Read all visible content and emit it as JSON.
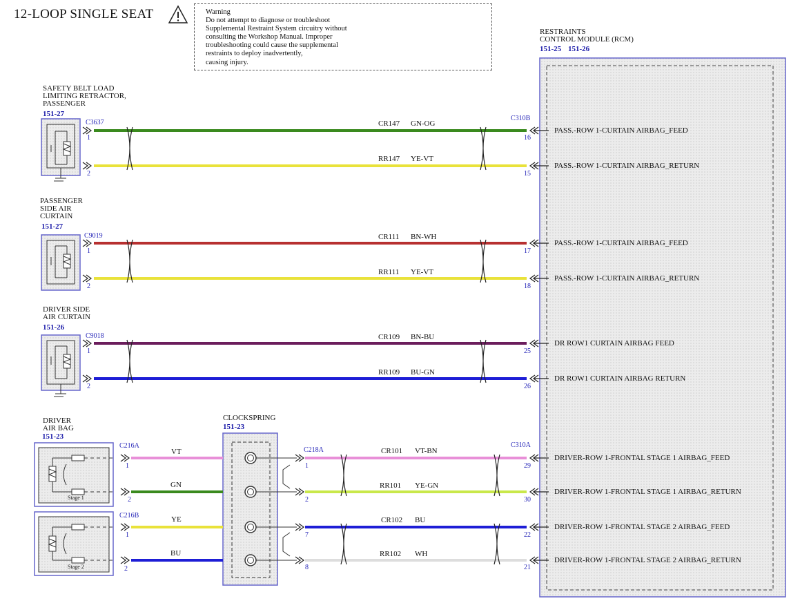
{
  "title": "12-LOOP SINGLE SEAT",
  "warning": {
    "icon": "warning-triangle-icon",
    "text": "Warning\nDo not attempt to diagnose or troubleshoot\nSupplemental Restraint System circuitry without\nconsulting the Workshop Manual. Improper\ntroubleshooting could cause the supplemental\nrestraints to deploy inadvertently,\ncausing injury."
  },
  "rcm": {
    "label": "RESTRAINTS\nCONTROL MODULE (RCM)",
    "ref1": "151-25",
    "ref2": "151-26"
  },
  "colors": {
    "GN": "#3a8a1e",
    "YE": "#e9e23a",
    "BN": "#8b2a1f",
    "RD": "#b73030",
    "VT": "#6b1d5c",
    "BU": "#1e1ed6",
    "PK": "#e88fd8",
    "LGN": "#c9e84a",
    "WH": "#dddddd",
    "frame": "#6666cc"
  },
  "components": [
    {
      "name": "SAFETY BELT LOAD\nLIMITING RETRACTOR,\nPASSENGER",
      "ref": "151-27",
      "connector": "C3637"
    },
    {
      "name": "PASSENGER\nSIDE AIR\nCURTAIN",
      "ref": "151-27",
      "connector": "C9019"
    },
    {
      "name": "DRIVER SIDE\nAIR CURTAIN",
      "ref": "151-26",
      "connector": "C9018"
    },
    {
      "name": "DRIVER\nAIR BAG",
      "ref": "151-23",
      "connectorA": "C216A",
      "connectorB": "C216B",
      "stage1": "Stage 1",
      "stage2": "Stage 2"
    }
  ],
  "clockspring": {
    "name": "CLOCKSPRING",
    "ref": "151-23",
    "connector": "C218A"
  },
  "rcm_connectors": {
    "top": "C310B",
    "bottom": "C310A"
  },
  "circuits": [
    {
      "circuit": "CR147",
      "color": "GN-OG",
      "pin_left": "1",
      "pin_rcm": "16",
      "signal": "PASS.-ROW 1-CURTAIN AIRBAG_FEED"
    },
    {
      "circuit": "RR147",
      "color": "YE-VT",
      "pin_left": "2",
      "pin_rcm": "15",
      "signal": "PASS.-ROW 1-CURTAIN AIRBAG_RETURN"
    },
    {
      "circuit": "CR111",
      "color": "BN-WH",
      "pin_left": "1",
      "pin_rcm": "17",
      "signal": "PASS.-ROW 1-CURTAIN AIRBAG_FEED"
    },
    {
      "circuit": "RR111",
      "color": "YE-VT",
      "pin_left": "2",
      "pin_rcm": "18",
      "signal": "PASS.-ROW 1-CURTAIN AIRBAG_RETURN"
    },
    {
      "circuit": "CR109",
      "color": "BN-BU",
      "pin_left": "1",
      "pin_rcm": "25",
      "signal": "DR ROW1 CURTAIN AIRBAG FEED"
    },
    {
      "circuit": "RR109",
      "color": "BU-GN",
      "pin_left": "2",
      "pin_rcm": "26",
      "signal": "DR ROW1 CURTAIN AIRBAG RETURN"
    },
    {
      "circuit": "CR101",
      "color": "VT-BN",
      "pin_left": "1",
      "pin_cs": "1",
      "pin_rcm": "29",
      "signal": "DRIVER-ROW 1-FRONTAL STAGE 1 AIRBAG_FEED",
      "short_color": "VT"
    },
    {
      "circuit": "RR101",
      "color": "YE-GN",
      "pin_left": "2",
      "pin_cs": "2",
      "pin_rcm": "30",
      "signal": "DRIVER-ROW 1-FRONTAL STAGE 1 AIRBAG_RETURN",
      "short_color": "GN"
    },
    {
      "circuit": "CR102",
      "color": "BU",
      "pin_left": "1",
      "pin_cs": "7",
      "pin_rcm": "22",
      "signal": "DRIVER-ROW 1-FRONTAL STAGE 2 AIRBAG_FEED",
      "short_color": "YE"
    },
    {
      "circuit": "RR102",
      "color": "WH",
      "pin_left": "2",
      "pin_cs": "8",
      "pin_rcm": "21",
      "signal": "DRIVER-ROW 1-FRONTAL STAGE 2 AIRBAG_RETURN",
      "short_color": "BU"
    }
  ]
}
